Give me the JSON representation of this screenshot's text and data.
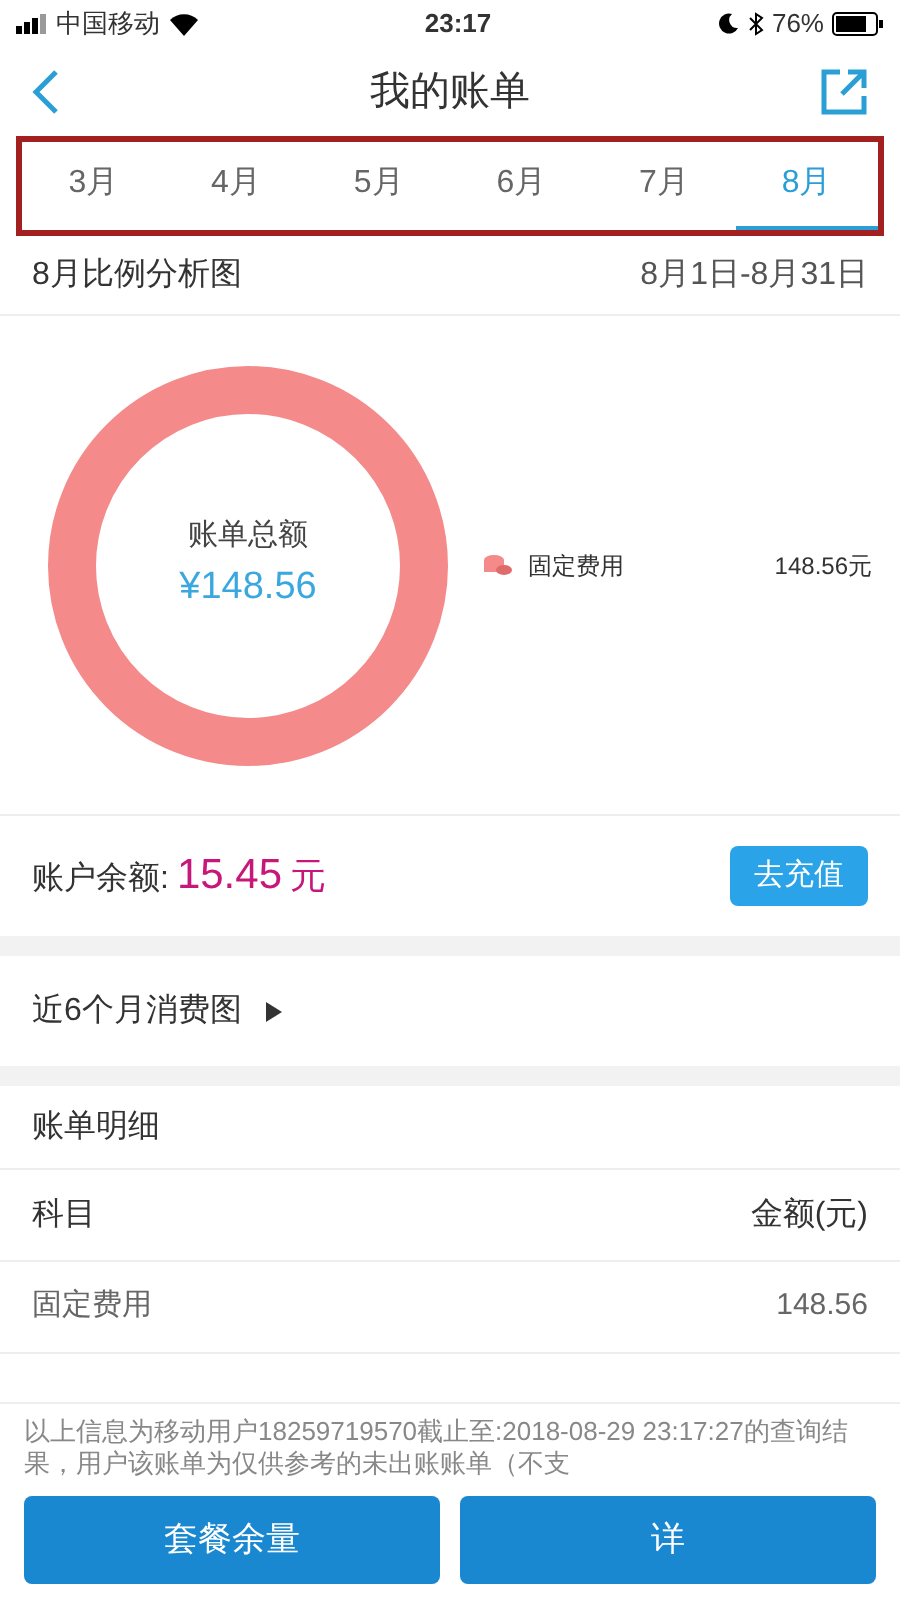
{
  "status_bar": {
    "carrier": "中国移动",
    "time": "23:17",
    "battery": "76%"
  },
  "nav": {
    "title": "我的账单"
  },
  "tabs": [
    {
      "label": "3月",
      "selected": false
    },
    {
      "label": "4月",
      "selected": false
    },
    {
      "label": "5月",
      "selected": false
    },
    {
      "label": "6月",
      "selected": false
    },
    {
      "label": "7月",
      "selected": false
    },
    {
      "label": "8月",
      "selected": true
    }
  ],
  "analysis": {
    "title": "8月比例分析图",
    "range": "8月1日-8月31日",
    "center_label": "账单总额",
    "center_value": "¥148.56",
    "legend": [
      {
        "label": "固定费用",
        "value": "148.56元"
      }
    ]
  },
  "balance": {
    "label": "账户余额:",
    "value": "15.45",
    "unit": "元",
    "button": "去充值"
  },
  "trend_link": "近6个月消费图",
  "details": {
    "title": "账单明细",
    "columns": [
      "科目",
      "金额(元)"
    ],
    "rows": [
      [
        "固定费用",
        "148.56"
      ]
    ]
  },
  "footer": {
    "note": "以上信息为移动用户18259719570截止至:2018-08-29 23:17:27的查询结果，用户该账单为仅供参考的未出账账单（不支",
    "buttons": [
      "套餐余量",
      "详"
    ]
  }
}
